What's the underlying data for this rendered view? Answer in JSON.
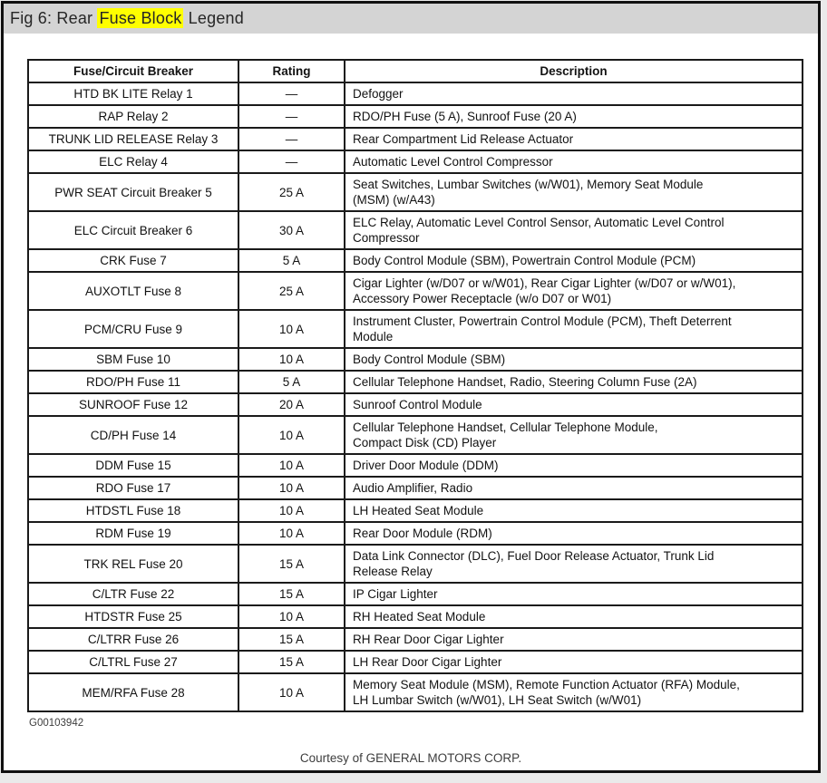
{
  "page": {
    "title_prefix": "Fig 6: Rear ",
    "title_highlight": "Fuse Block",
    "title_suffix": " Legend",
    "figure_code": "G00103942",
    "courtesy": "Courtesy of GENERAL MOTORS CORP.",
    "colors": {
      "title_bar_bg": "#d4d4d4",
      "highlight": "#ffff00",
      "frame_border": "#101010",
      "table_border": "#1a1a1a",
      "outer_bg": "#eaeaea"
    }
  },
  "table": {
    "headers": [
      "Fuse/Circuit Breaker",
      "Rating",
      "Description"
    ],
    "rows": [
      {
        "name": "HTD BK LITE Relay 1",
        "rating": "—",
        "description": "Defogger"
      },
      {
        "name": "RAP Relay 2",
        "rating": "—",
        "description": "RDO/PH Fuse (5 A), Sunroof Fuse (20 A)"
      },
      {
        "name": "TRUNK LID RELEASE Relay 3",
        "rating": "—",
        "description": "Rear Compartment Lid Release Actuator"
      },
      {
        "name": "ELC Relay 4",
        "rating": "—",
        "description": "Automatic Level Control Compressor"
      },
      {
        "name": "PWR SEAT Circuit Breaker 5",
        "rating": "25 A",
        "description": "Seat Switches, Lumbar Switches (w/W01), Memory Seat Module\n(MSM) (w/A43)"
      },
      {
        "name": "ELC Circuit Breaker 6",
        "rating": "30 A",
        "description": "ELC Relay, Automatic Level Control Sensor, Automatic Level Control\nCompressor"
      },
      {
        "name": "CRK Fuse 7",
        "rating": "5 A",
        "description": "Body Control Module (SBM), Powertrain Control Module (PCM)"
      },
      {
        "name": "AUXOTLT Fuse 8",
        "rating": "25 A",
        "description": "Cigar Lighter (w/D07 or w/W01), Rear Cigar Lighter (w/D07 or w/W01),\nAccessory Power Receptacle (w/o D07 or W01)"
      },
      {
        "name": "PCM/CRU Fuse 9",
        "rating": "10 A",
        "description": "Instrument Cluster, Powertrain Control Module (PCM), Theft Deterrent\nModule"
      },
      {
        "name": "SBM Fuse 10",
        "rating": "10 A",
        "description": "Body Control Module (SBM)"
      },
      {
        "name": "RDO/PH Fuse 11",
        "rating": "5 A",
        "description": "Cellular Telephone Handset, Radio, Steering Column Fuse (2A)"
      },
      {
        "name": "SUNROOF Fuse 12",
        "rating": "20 A",
        "description": "Sunroof Control Module"
      },
      {
        "name": "CD/PH Fuse 14",
        "rating": "10 A",
        "description": "Cellular Telephone Handset, Cellular Telephone Module,\nCompact Disk (CD) Player"
      },
      {
        "name": "DDM Fuse 15",
        "rating": "10 A",
        "description": "Driver Door Module (DDM)"
      },
      {
        "name": "RDO Fuse 17",
        "rating": "10 A",
        "description": "Audio Amplifier, Radio"
      },
      {
        "name": "HTDSTL Fuse 18",
        "rating": "10 A",
        "description": "LH Heated Seat Module"
      },
      {
        "name": "RDM Fuse 19",
        "rating": "10 A",
        "description": "Rear Door Module (RDM)"
      },
      {
        "name": "TRK REL Fuse 20",
        "rating": "15 A",
        "description": "Data Link Connector (DLC), Fuel Door Release Actuator, Trunk Lid\nRelease Relay"
      },
      {
        "name": "C/LTR Fuse 22",
        "rating": "15 A",
        "description": "IP Cigar Lighter"
      },
      {
        "name": "HTDSTR Fuse 25",
        "rating": "10 A",
        "description": "RH Heated Seat Module"
      },
      {
        "name": "C/LTRR Fuse 26",
        "rating": "15 A",
        "description": "RH Rear Door Cigar Lighter"
      },
      {
        "name": "C/LTRL Fuse 27",
        "rating": "15 A",
        "description": "LH Rear Door Cigar Lighter"
      },
      {
        "name": "MEM/RFA Fuse 28",
        "rating": "10 A",
        "description": "Memory Seat Module (MSM), Remote Function Actuator (RFA) Module,\nLH Lumbar Switch (w/W01), LH Seat Switch (w/W01)"
      }
    ]
  }
}
